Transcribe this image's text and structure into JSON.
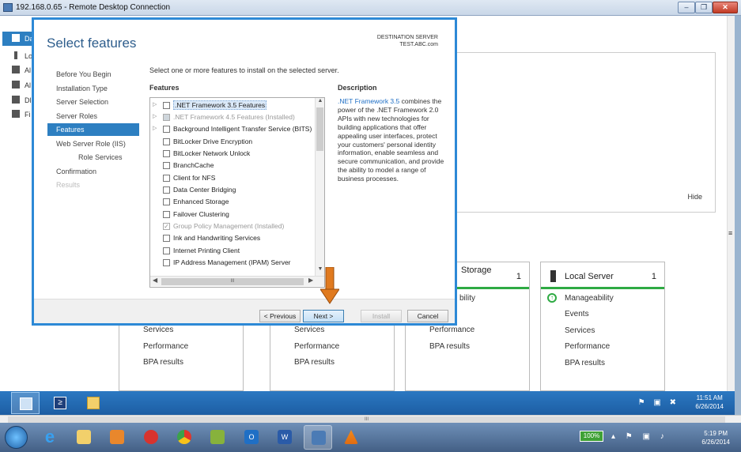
{
  "rdp": {
    "title": "192.168.0.65 - Remote Desktop Connection"
  },
  "server_manager": {
    "nav_items": [
      {
        "label": "Da",
        "icon": "dashboard-icon",
        "active": true
      },
      {
        "label": "Lo",
        "icon": "local-server-icon"
      },
      {
        "label": "Al",
        "icon": "all-servers-icon"
      },
      {
        "label": "Al",
        "icon": "ad-icon"
      },
      {
        "label": "Dl",
        "icon": "dns-icon"
      },
      {
        "label": "Fi",
        "icon": "file-services-icon"
      }
    ],
    "hide_label": "Hide",
    "tiles": [
      {
        "title": "",
        "count": "",
        "rows": [
          "Services",
          "Performance",
          "BPA results"
        ]
      },
      {
        "title": "",
        "count": "",
        "rows": [
          "Services",
          "Performance",
          "BPA results"
        ]
      },
      {
        "title": "Storage",
        "count": "1",
        "rows": [
          "bility",
          "",
          "Performance",
          "BPA results"
        ]
      },
      {
        "title": "Local Server",
        "count": "1",
        "rows": [
          "Manageability",
          "Events",
          "Services",
          "Performance",
          "BPA results"
        ]
      }
    ]
  },
  "wizard": {
    "title": "Select features",
    "destination_label": "DESTINATION SERVER",
    "destination_value": "TEST.ABC.com",
    "steps": [
      {
        "label": "Before You Begin",
        "state": "normal"
      },
      {
        "label": "Installation Type",
        "state": "normal"
      },
      {
        "label": "Server Selection",
        "state": "normal"
      },
      {
        "label": "Server Roles",
        "state": "normal"
      },
      {
        "label": "Features",
        "state": "active"
      },
      {
        "label": "Web Server Role (IIS)",
        "state": "normal"
      },
      {
        "label": "Role Services",
        "state": "sub"
      },
      {
        "label": "Confirmation",
        "state": "normal"
      },
      {
        "label": "Results",
        "state": "disabled"
      }
    ],
    "intro": "Select one or more features to install on the selected server.",
    "features_header": "Features",
    "description_header": "Description",
    "features": [
      {
        "label": ".NET Framework 3.5 Features",
        "expandable": true,
        "state": "unchecked",
        "selected": true
      },
      {
        "label": ".NET Framework 4.5 Features (Installed)",
        "expandable": true,
        "state": "partial",
        "dim": true
      },
      {
        "label": "Background Intelligent Transfer Service (BITS)",
        "expandable": true,
        "state": "unchecked"
      },
      {
        "label": "BitLocker Drive Encryption",
        "state": "unchecked"
      },
      {
        "label": "BitLocker Network Unlock",
        "state": "unchecked"
      },
      {
        "label": "BranchCache",
        "state": "unchecked"
      },
      {
        "label": "Client for NFS",
        "state": "unchecked"
      },
      {
        "label": "Data Center Bridging",
        "state": "unchecked"
      },
      {
        "label": "Enhanced Storage",
        "state": "unchecked"
      },
      {
        "label": "Failover Clustering",
        "state": "unchecked"
      },
      {
        "label": "Group Policy Management (Installed)",
        "state": "checked",
        "dim": true
      },
      {
        "label": "Ink and Handwriting Services",
        "state": "unchecked"
      },
      {
        "label": "Internet Printing Client",
        "state": "unchecked"
      },
      {
        "label": "IP Address Management (IPAM) Server",
        "state": "unchecked"
      }
    ],
    "description_link": ".NET Framework 3.5",
    "description_body": " combines the power of the .NET Framework 2.0 APIs with new technologies for building applications that offer appealing user interfaces, protect your customers' personal identity information, enable seamless and secure communication, and provide the ability to model a range of business processes.",
    "buttons": {
      "previous": "< Previous",
      "next": "Next >",
      "install": "Install",
      "cancel": "Cancel"
    },
    "arrow_color": "#e07a1f"
  },
  "remote_taskbar": {
    "time": "11:51 AM",
    "date": "6/26/2014"
  },
  "local_taskbar": {
    "battery": "100%",
    "time": "5:19 PM",
    "date": "6/26/2014"
  },
  "colors": {
    "accent": "#2d7fc1",
    "green": "#2eaa43"
  }
}
